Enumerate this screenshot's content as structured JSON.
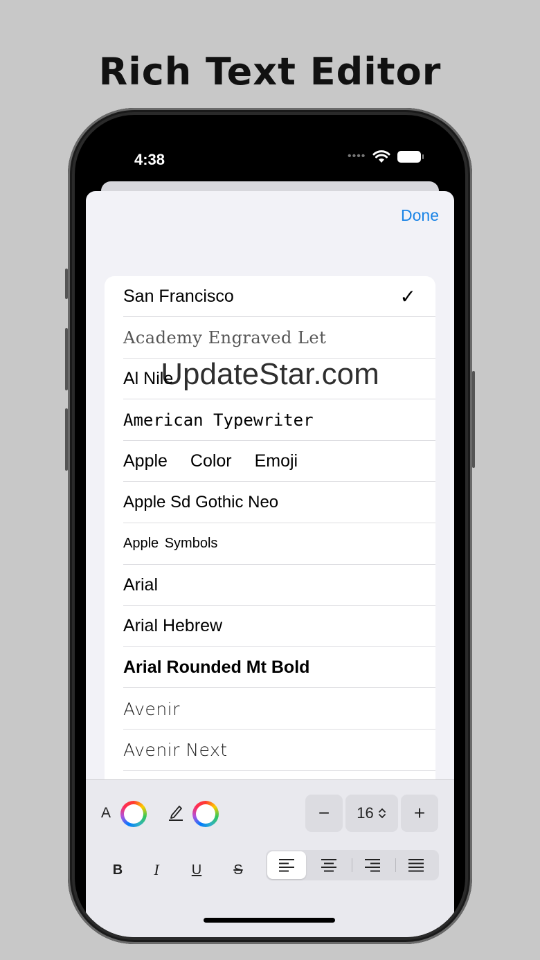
{
  "headline": "Rich Text Editor",
  "status": {
    "time": "4:38"
  },
  "sheet": {
    "done_label": "Done"
  },
  "fonts": [
    {
      "name": "San Francisco",
      "selected": true
    },
    {
      "name": "Academy Engraved Let"
    },
    {
      "name": "Al Nile"
    },
    {
      "name": "American Typewriter"
    },
    {
      "name": "Apple Color Emoji"
    },
    {
      "name": "Apple Sd Gothic Neo"
    },
    {
      "name": "Apple Symbols"
    },
    {
      "name": "Arial"
    },
    {
      "name": "Arial Hebrew"
    },
    {
      "name": "Arial Rounded Mt Bold"
    },
    {
      "name": "Avenir"
    },
    {
      "name": "Avenir Next"
    }
  ],
  "check_glyph": "✓",
  "watermark": "UpdateStar.com",
  "toolbar": {
    "text_color_label": "A",
    "decrease_label": "−",
    "font_size": "16",
    "increase_label": "+",
    "bold_label": "B",
    "italic_label": "I",
    "underline_label": "U",
    "strike_label": "S",
    "active_alignment": "left"
  },
  "colors": {
    "accent": "#1a84e6",
    "sheet_bg": "#f2f2f7",
    "toolbar_bg": "#e9e9ee"
  }
}
